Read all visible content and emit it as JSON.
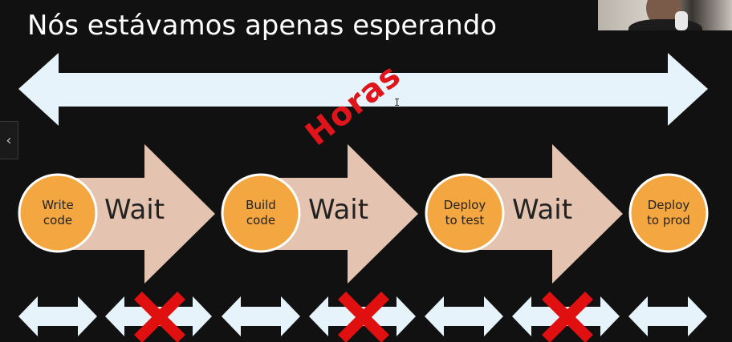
{
  "slide": {
    "title": "Nós estávamos apenas esperando",
    "annotation": "Horas"
  },
  "pipeline": {
    "stages": [
      {
        "line1": "Write",
        "line2": "code"
      },
      {
        "line1": "Build",
        "line2": "code"
      },
      {
        "line1": "Deploy",
        "line2": "to test"
      },
      {
        "line1": "Deploy",
        "line2": "to prod"
      }
    ],
    "wait_label": "Wait"
  },
  "colors": {
    "background": "#111111",
    "arrow_fill": "#e6f3fb",
    "stage_circle": "#f4a740",
    "wait_arrow": "#e4c4b0",
    "annotation": "#e0141b",
    "cross": "#e01010"
  },
  "icons": {
    "previous_slide": "chevron-left-icon"
  }
}
